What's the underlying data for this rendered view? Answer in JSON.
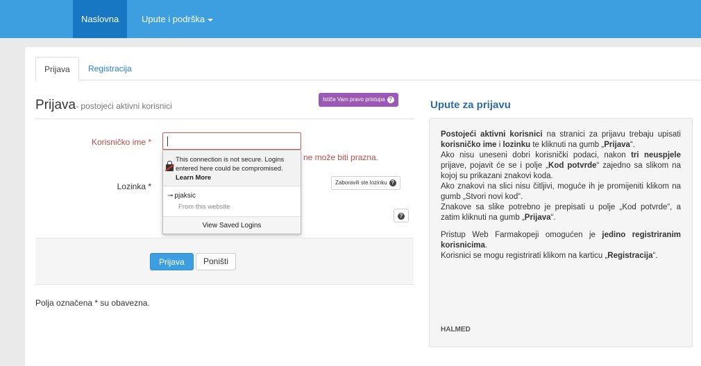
{
  "nav": {
    "home": "Naslovna",
    "support": "Upute i podrška"
  },
  "tabs": {
    "login": "Prijava",
    "register": "Registracija"
  },
  "form": {
    "title": "Prijava",
    "subtitle": "- postojeći aktivni korisnici",
    "expiry_badge": "Ističe Vam pravo pristupa",
    "username_label": "Korisničko ime *",
    "username_value": "",
    "username_error": "ne može biti prazna.",
    "password_label": "Lozinka *",
    "forgot_button": "Zaboravili ste lozinku",
    "login_button": "Prijava",
    "reset_button": "Poništi",
    "required_note": "Polja označena * su obavezna."
  },
  "autofill_popup": {
    "warning": "This connection is not secure. Logins entered here could be compromised.",
    "learn_more": "Learn More",
    "saved_username": "pjaksic",
    "saved_source": "From this website",
    "view_saved": "View Saved Logins"
  },
  "help": {
    "title": "Upute za prijavu",
    "paragraphs": [
      [
        {
          "t": "Postojeći aktivni korisnici",
          "b": true
        },
        {
          "t": " na stranici za prijavu trebaju upisati ",
          "b": false
        },
        {
          "t": "korisničko ime",
          "b": true
        },
        {
          "t": " i ",
          "b": false
        },
        {
          "t": "lozinku",
          "b": true
        },
        {
          "t": " te kliknuti na gumb „",
          "b": false
        },
        {
          "t": "Prijava",
          "b": true
        },
        {
          "t": "“.",
          "b": false
        }
      ],
      [
        {
          "t": "Ako nisu uneseni dobri korisnički podaci, nakon ",
          "b": false
        },
        {
          "t": "tri neuspjele",
          "b": true
        },
        {
          "t": " prijave, pojavit će se i polje „",
          "b": false
        },
        {
          "t": "Kod potvrde",
          "b": true
        },
        {
          "t": "“ zajedno sa slikom na kojoj su prikazani znakovi koda.",
          "b": false
        }
      ],
      [
        {
          "t": "Ako znakovi na slici nisu čitljivi, moguće ih je promijeniti klikom na gumb „Stvori novi kod“.",
          "b": false
        }
      ],
      [
        {
          "t": "Znakove sa slike potrebno je prepisati u polje „Kod potvrde“, a zatim kliknuti na gumb „",
          "b": false
        },
        {
          "t": "Prijava",
          "b": true
        },
        {
          "t": "“.",
          "b": false
        }
      ],
      [
        {
          "t": "Pristup Web Farmakopeji omogućen je ",
          "b": false
        },
        {
          "t": "jedino registriranim korisnicima",
          "b": true
        },
        {
          "t": ".",
          "b": false
        }
      ],
      [
        {
          "t": "Korisnici se mogu registrirati klikom na karticu „",
          "b": false
        },
        {
          "t": "Registracija",
          "b": true
        },
        {
          "t": "“.",
          "b": false
        }
      ]
    ],
    "signature": "HALMED"
  },
  "icons": {
    "help": "question-circle-icon",
    "caret": "chevron-down-icon",
    "lock": "insecure-lock-icon",
    "key": "key-icon"
  },
  "colors": {
    "navbar": "#3e9fe0",
    "nav_active": "#1777c2",
    "primary_button": "#3e9fe0",
    "badge": "#9b59b6",
    "error": "#b94a48",
    "help_title": "#2f6ca7"
  }
}
